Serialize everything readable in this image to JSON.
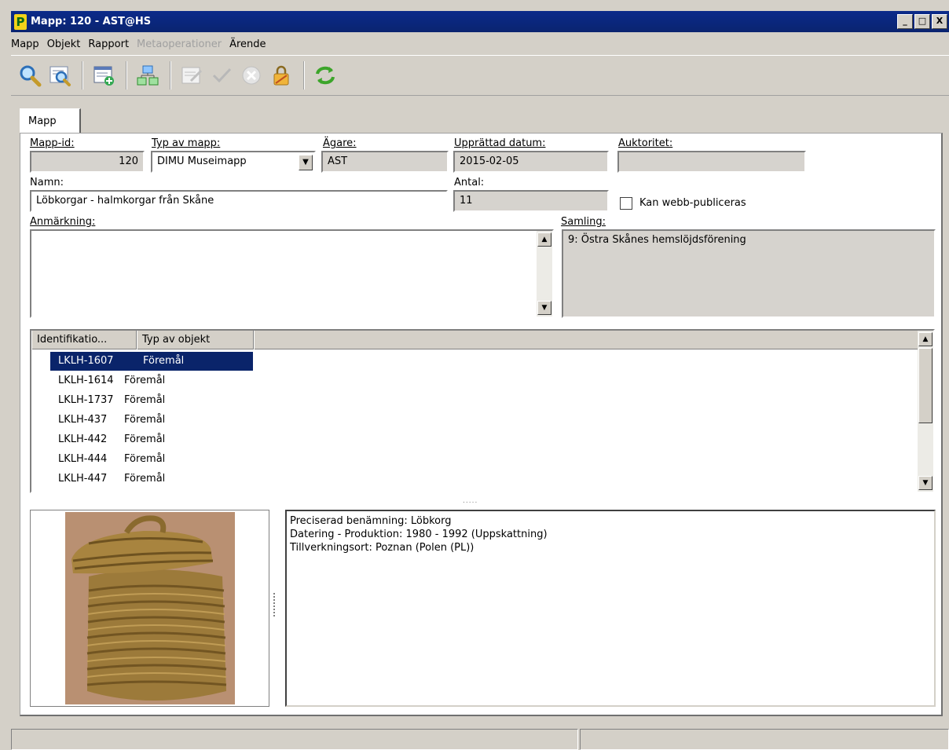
{
  "window": {
    "title": "Mapp: 120 - AST@HS",
    "app_icon": "P",
    "buttons": {
      "minimize": "_",
      "maximize": "□",
      "close": "X"
    }
  },
  "menu": [
    {
      "label": "Mapp",
      "enabled": true
    },
    {
      "label": "Objekt",
      "enabled": true
    },
    {
      "label": "Rapport",
      "enabled": true
    },
    {
      "label": "Metaoperationer",
      "enabled": false
    },
    {
      "label": "Ärende",
      "enabled": true
    }
  ],
  "toolbar": {
    "icons": [
      "search-icon",
      "search-list-icon",
      "new-record-icon",
      "network-icon",
      "edit-icon",
      "checkmark-icon",
      "cancel-icon",
      "lock-icon",
      "refresh-icon"
    ],
    "colors": {
      "accent": "#0a246a"
    }
  },
  "tab": {
    "label": "Mapp"
  },
  "form": {
    "mapp_id": {
      "label": "Mapp-id:",
      "value": "120"
    },
    "typ": {
      "label": "Typ av mapp:",
      "value": "DIMU Museimapp"
    },
    "agare": {
      "label": "Ägare:",
      "value": "AST"
    },
    "upprattad": {
      "label": "Upprättad datum:",
      "value": "2015-02-05"
    },
    "auktoritet": {
      "label": "Auktoritet:",
      "value": ""
    },
    "namn": {
      "label": "Namn:",
      "value": "Löbkorgar - halmkorgar från Skåne"
    },
    "antal": {
      "label": "Antal:",
      "value": "11"
    },
    "webb": {
      "label": "Kan webb-publiceras",
      "checked": false
    },
    "anmarkning": {
      "label": "Anmärkning:",
      "value": ""
    },
    "samling": {
      "label": "Samling:",
      "value": "9: Östra Skånes hemslöjdsförening"
    }
  },
  "list": {
    "columns": [
      "Identifikatio...",
      "Typ av objekt"
    ],
    "rows": [
      {
        "id": "LKLH-1607",
        "type": "Föremål",
        "selected": true
      },
      {
        "id": "LKLH-1614",
        "type": "Föremål",
        "selected": false
      },
      {
        "id": "LKLH-1737",
        "type": "Föremål",
        "selected": false
      },
      {
        "id": "LKLH-437",
        "type": "Föremål",
        "selected": false
      },
      {
        "id": "LKLH-442",
        "type": "Föremål",
        "selected": false
      },
      {
        "id": "LKLH-444",
        "type": "Föremål",
        "selected": false
      },
      {
        "id": "LKLH-447",
        "type": "Föremål",
        "selected": false
      }
    ]
  },
  "splitter": ".....",
  "details": {
    "line1": "Preciserad benämning: Löbkorg",
    "line2": "Datering - Produktion: 1980 - 1992  (Uppskattning)",
    "line3": "Tillverkningsort: Poznan (Polen (PL))"
  }
}
